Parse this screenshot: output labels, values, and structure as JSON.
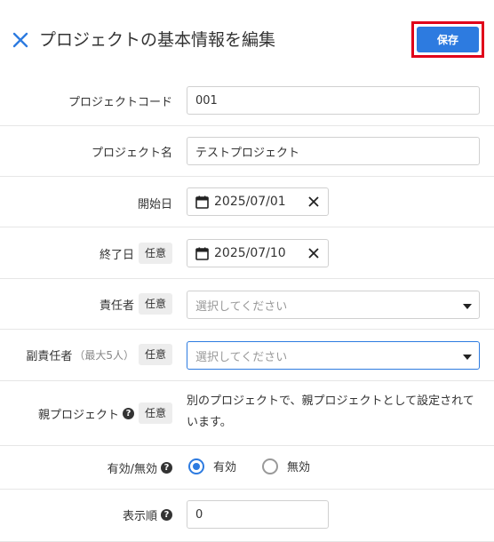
{
  "header": {
    "title": "プロジェクトの基本情報を編集",
    "save_label": "保存"
  },
  "badges": {
    "optional": "任意",
    "help": "?"
  },
  "fields": {
    "code": {
      "label": "プロジェクトコード",
      "value": "001"
    },
    "name": {
      "label": "プロジェクト名",
      "value": "テストプロジェクト"
    },
    "start_date": {
      "label": "開始日",
      "value": "2025/07/01"
    },
    "end_date": {
      "label": "終了日",
      "value": "2025/07/10"
    },
    "owner": {
      "label": "責任者",
      "placeholder": "選択してください"
    },
    "deputy": {
      "label": "副責任者",
      "label_note": "（最大5人）",
      "placeholder": "選択してください"
    },
    "parent": {
      "label": "親プロジェクト",
      "description": "別のプロジェクトで、親プロジェクトとして設定されています。"
    },
    "status": {
      "label": "有効/無効",
      "options": [
        "有効",
        "無効"
      ],
      "selected": "有効"
    },
    "order": {
      "label": "表示順",
      "value": "0"
    }
  }
}
